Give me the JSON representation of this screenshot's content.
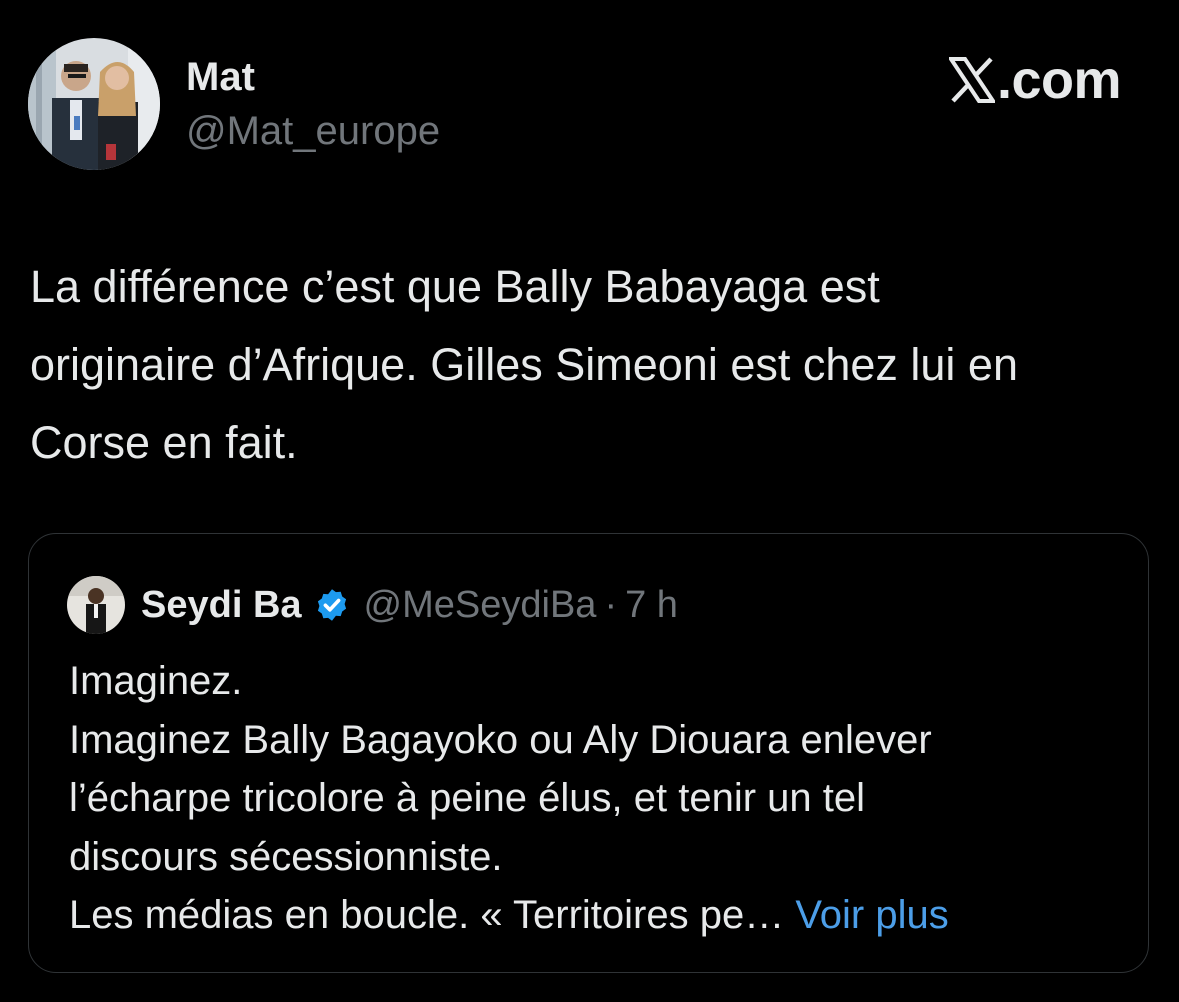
{
  "author": {
    "name": "Mat",
    "handle": "@Mat_europe",
    "avatar_icon": "profile-photo"
  },
  "brand": {
    "icon": "x-logo",
    "label": ".com"
  },
  "tweet": {
    "lines": [
      "La différence c’est que Bally Babayaga est",
      "originaire d’Afrique. Gilles Simeoni est chez lui en",
      "Corse en fait."
    ]
  },
  "quoted_tweet": {
    "name": "Seydi Ba",
    "verified_icon": "verified-badge-icon",
    "handle": "@MeSeydiBa",
    "separator": "·",
    "time": "7 h",
    "lines": [
      "Imaginez.",
      "Imaginez Bally Bagayoko ou Aly Diouara enlever",
      "l’écharpe tricolore à peine élus, et tenir un tel",
      "discours sécessionniste."
    ],
    "last_line": "Les médias en boucle. « Territoires pe…",
    "more_link": " Voir plus"
  },
  "colors": {
    "background": "#000000",
    "text_primary": "#e7e9ea",
    "text_secondary": "#71767b",
    "link": "#4c9ee8",
    "verified": "#1d9bf0",
    "border": "#2f3336"
  }
}
